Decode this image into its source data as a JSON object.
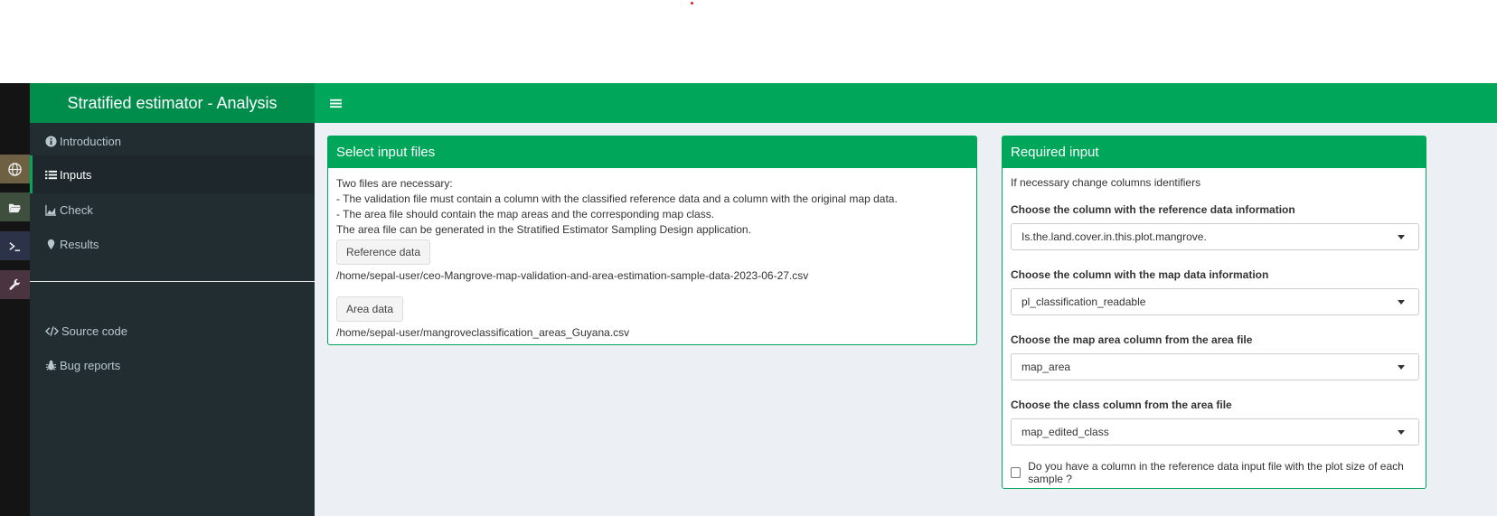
{
  "app": {
    "title": "Stratified estimator - Analysis",
    "accent": "#00a65a",
    "logo_bg": "#008d4c",
    "sidebar_bg": "#222d32"
  },
  "left_strip": {
    "icons": [
      "globe-icon",
      "folder-open-icon",
      "terminal-icon",
      "wrench-icon"
    ]
  },
  "sidebar": {
    "items": [
      {
        "label": "Introduction",
        "icon": "info-circle-icon"
      },
      {
        "label": "Inputs",
        "icon": "list-icon"
      },
      {
        "label": "Check",
        "icon": "area-chart-icon"
      },
      {
        "label": "Results",
        "icon": "map-marker-icon"
      },
      {
        "label": "Source code",
        "icon": "code-icon"
      },
      {
        "label": "Bug reports",
        "icon": "bug-icon"
      }
    ],
    "active": "Inputs"
  },
  "select_files": {
    "title": "Select input files",
    "lines": [
      "Two files are necessary:",
      "- The validation file must contain a column with the classified reference data and a column with the original map data.",
      "- The area file should contain the map areas and the corresponding map class.",
      "The area file can be generated in the Stratified Estimator Sampling Design application."
    ],
    "reference_button": "Reference data",
    "reference_path": "/home/sepal-user/ceo-Mangrove-map-validation-and-area-estimation-sample-data-2023-06-27.csv",
    "area_button": "Area data",
    "area_path": "/home/sepal-user/mangroveclassification_areas_Guyana.csv"
  },
  "required_input": {
    "title": "Required input",
    "note": "If necessary change columns identifiers",
    "fields": [
      {
        "label": "Choose the column with the reference data information",
        "value": "Is.the.land.cover.in.this.plot.mangrove."
      },
      {
        "label": "Choose the column with the map data information",
        "value": "pl_classification_readable"
      },
      {
        "label": "Choose the map area column from the area file",
        "value": "map_area"
      },
      {
        "label": "Choose the class column from the area file",
        "value": "map_edited_class"
      }
    ],
    "plot_size_checkbox": "Do you have a column in the reference data input file with the plot size of each sample ?"
  }
}
